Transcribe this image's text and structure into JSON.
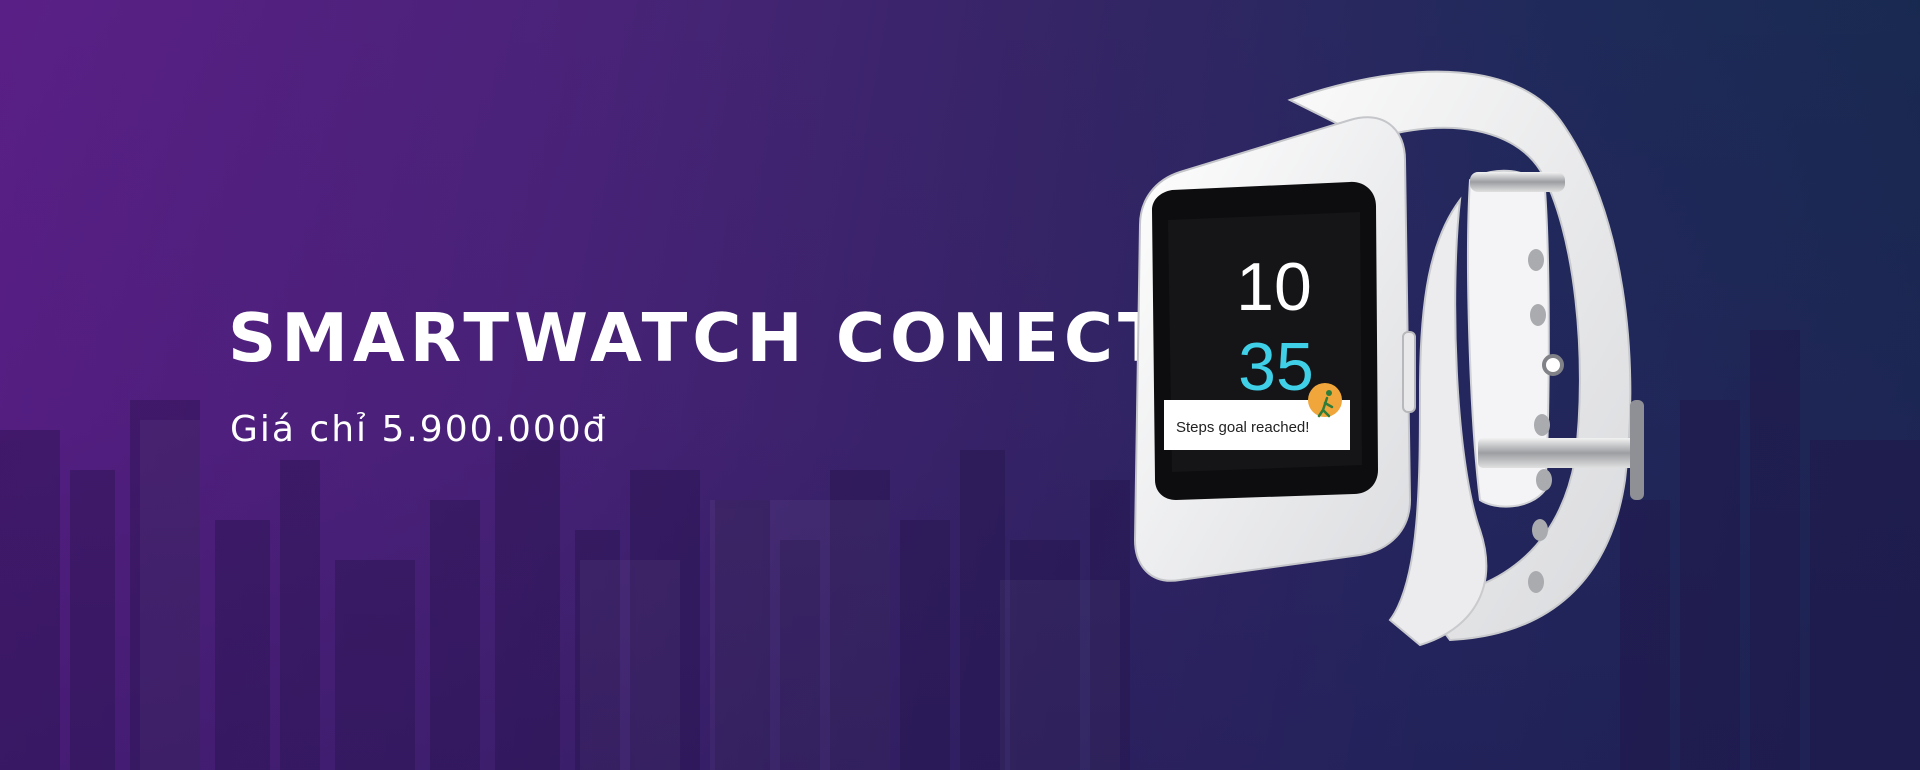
{
  "banner": {
    "title": "SMARTWATCH CONECT",
    "price": "Giá chỉ 5.900.000đ"
  },
  "watch": {
    "hour": "10",
    "minute": "35",
    "notification": "Steps goal reached!",
    "notification_icon": "walking-person-icon",
    "minute_color": "#3fd0e8"
  },
  "colors": {
    "gradient_left": "#5a1f86",
    "gradient_right": "#16294d",
    "text": "#ffffff"
  }
}
